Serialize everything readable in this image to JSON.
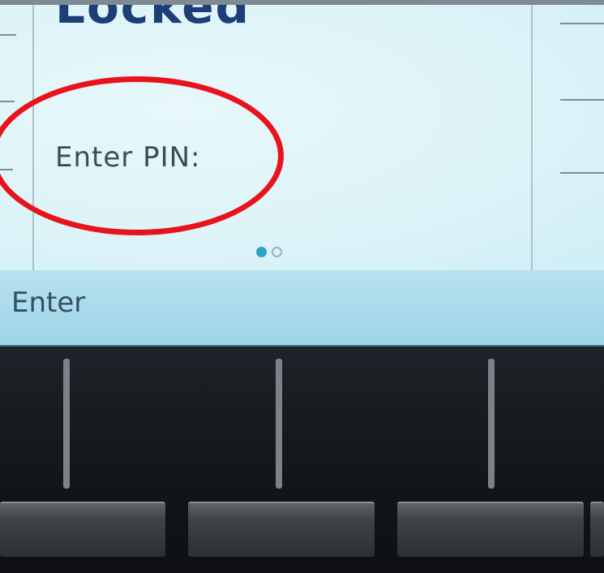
{
  "screen": {
    "title": "Locked",
    "pin_prompt": "Enter PIN:",
    "page_indicator": {
      "pages": 2,
      "current": 1
    }
  },
  "softkeys": [
    {
      "label": "Enter"
    }
  ],
  "colors": {
    "title": "#1d3f78",
    "screen_background": "#dcf3f8",
    "softkey_bar": "#a9d9eb",
    "annotation": "#e8131c",
    "active_dot": "#2aa3c6"
  },
  "icons": [
    "page-dot-active",
    "page-dot-inactive",
    "red-annotation-circle"
  ]
}
